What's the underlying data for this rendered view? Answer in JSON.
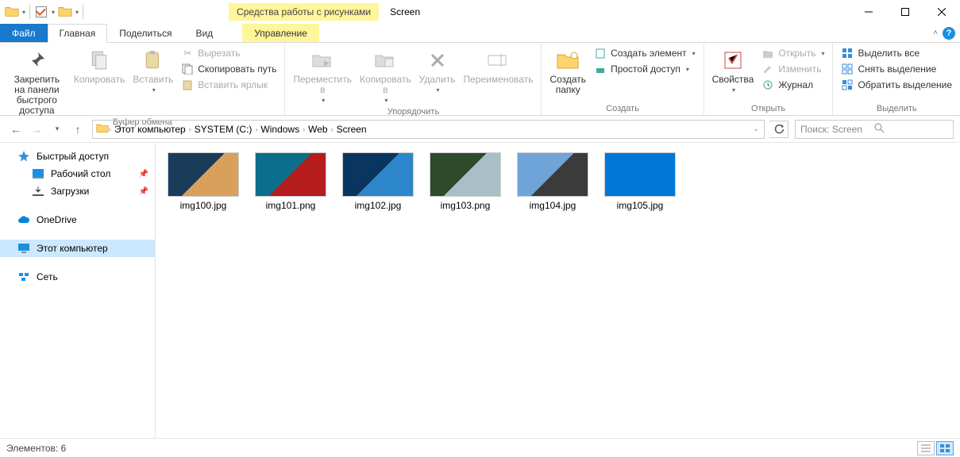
{
  "titlebar": {
    "contextual_tab": "Средства работы с рисунками",
    "title": "Screen"
  },
  "tabs": {
    "file": "Файл",
    "home": "Главная",
    "share": "Поделиться",
    "view": "Вид",
    "manage": "Управление"
  },
  "ribbon": {
    "clipboard": {
      "pin": "Закрепить на панели\nбыстрого доступа",
      "copy": "Копировать",
      "paste": "Вставить",
      "cut": "Вырезать",
      "copy_path": "Скопировать путь",
      "paste_shortcut": "Вставить ярлык",
      "group": "Буфер обмена"
    },
    "organize": {
      "move_to": "Переместить\nв",
      "copy_to": "Копировать\nв",
      "delete": "Удалить",
      "rename": "Переименовать",
      "group": "Упорядочить"
    },
    "new": {
      "new_folder": "Создать\nпапку",
      "new_item": "Создать элемент",
      "easy_access": "Простой доступ",
      "group": "Создать"
    },
    "open": {
      "properties": "Свойства",
      "open": "Открыть",
      "edit": "Изменить",
      "history": "Журнал",
      "group": "Открыть"
    },
    "select": {
      "select_all": "Выделить все",
      "select_none": "Снять выделение",
      "invert": "Обратить выделение",
      "group": "Выделить"
    }
  },
  "breadcrumb": [
    "Этот компьютер",
    "SYSTEM (C:)",
    "Windows",
    "Web",
    "Screen"
  ],
  "search_placeholder": "Поиск: Screen",
  "nav": {
    "quick_access": "Быстрый доступ",
    "desktop": "Рабочий стол",
    "downloads": "Загрузки",
    "onedrive": "OneDrive",
    "this_pc": "Этот компьютер",
    "network": "Сеть"
  },
  "files": [
    {
      "name": "img100.jpg",
      "colors": [
        "#1b3b5a",
        "#d8a05a"
      ]
    },
    {
      "name": "img101.png",
      "colors": [
        "#0b6e8a",
        "#b51d1d"
      ]
    },
    {
      "name": "img102.jpg",
      "colors": [
        "#0a3560",
        "#2d86c9"
      ]
    },
    {
      "name": "img103.png",
      "colors": [
        "#2d4a2a",
        "#a9bfc7"
      ]
    },
    {
      "name": "img104.jpg",
      "colors": [
        "#6fa4d9",
        "#3b3b3b"
      ]
    },
    {
      "name": "img105.jpg",
      "colors": [
        "#0078d7",
        "#0078d7"
      ]
    }
  ],
  "statusbar": {
    "count_label": "Элементов: 6"
  }
}
